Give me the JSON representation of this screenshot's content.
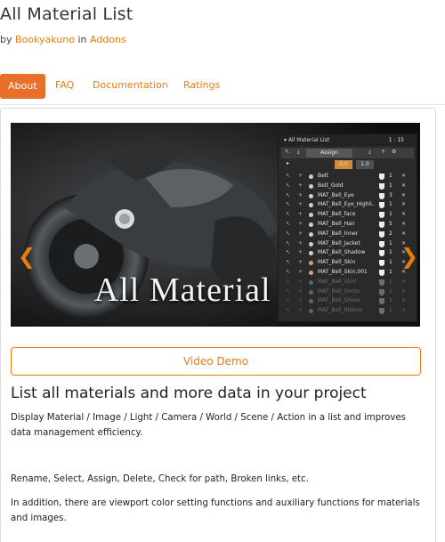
{
  "header": {
    "title": "All Material List",
    "by_prefix": "by",
    "author": "Bookyakuno",
    "in_word": "in",
    "category": "Addons"
  },
  "tabs": [
    {
      "label": "About",
      "active": true
    },
    {
      "label": "FAQ",
      "active": false
    },
    {
      "label": "Documentation",
      "active": false
    },
    {
      "label": "Ratings",
      "active": false
    }
  ],
  "carousel": {
    "banner_text": "All Material List",
    "slide_count": 3,
    "active_slide": 1,
    "panel": {
      "title": "All Material List",
      "count": "1 : 15",
      "assign_label": "Assign",
      "value_a": "0.0",
      "value_b": "1.0",
      "rows": [
        {
          "name": "Belt",
          "n": "1"
        },
        {
          "name": "Belt_Gold",
          "n": "1"
        },
        {
          "name": "MAT_Bell_Eye",
          "n": "3"
        },
        {
          "name": "MAT_Bell_Eye_Highli..",
          "n": "1"
        },
        {
          "name": "MAT_Bell_face",
          "n": "1"
        },
        {
          "name": "MAT_Bell_Hair",
          "n": "5"
        },
        {
          "name": "MAT_Bell_Inner",
          "n": "2"
        },
        {
          "name": "MAT_Bell_Jacket",
          "n": "1"
        },
        {
          "name": "MAT_Bell_Shadow",
          "n": "1"
        },
        {
          "name": "MAT_Bell_Skin",
          "n": "1"
        },
        {
          "name": "MAT_Bell_Skin.001",
          "n": "1"
        },
        {
          "name": "MAT_Bell_Skirt",
          "n": "1"
        },
        {
          "name": "MAT_Bell_Socks",
          "n": "1"
        },
        {
          "name": "MAT_Bell_Shoes",
          "n": "1"
        },
        {
          "name": "MAT_Bell_Ribbon",
          "n": "1"
        }
      ]
    }
  },
  "video_button": "Video Demo",
  "content": {
    "heading": "List all materials and more data in your project",
    "p1": "Display Material / Image / Light / Camera / World / Scene / Action in a list and improves data management efficiency.",
    "p2": "Rename, Select, Assign, Delete, Check for path, Broken links, etc.",
    "p3": "In addition, there are viewport color setting functions and auxiliary functions for materials and images."
  },
  "colors": {
    "accent": "#e87d0d",
    "tab_active_bg": "#e8702a"
  }
}
